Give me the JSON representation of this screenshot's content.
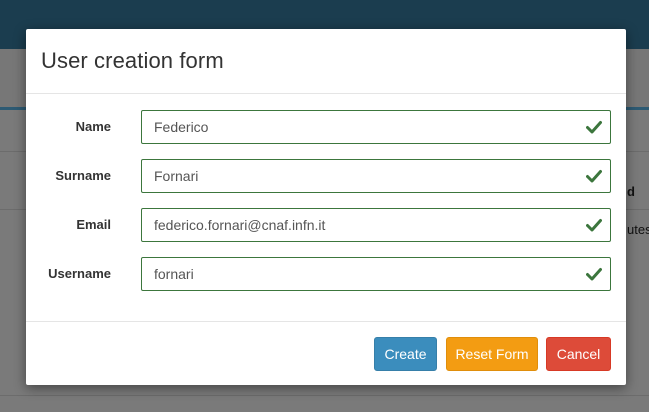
{
  "background": {
    "column_header": "d",
    "cell_text": "utes"
  },
  "modal": {
    "title": "User creation form",
    "fields": [
      {
        "label": "Name",
        "value": "Federico",
        "valid": true
      },
      {
        "label": "Surname",
        "value": "Fornari",
        "valid": true
      },
      {
        "label": "Email",
        "value": "federico.fornari@cnaf.infn.it",
        "valid": true
      },
      {
        "label": "Username",
        "value": "fornari",
        "valid": true
      }
    ],
    "buttons": {
      "create": "Create",
      "reset": "Reset Form",
      "cancel": "Cancel"
    }
  },
  "colors": {
    "valid_border": "#3c763d",
    "create": "#3b8dbd",
    "reset": "#f39c12",
    "cancel": "#dd4b39"
  },
  "icons": {
    "validation": "check-icon"
  }
}
